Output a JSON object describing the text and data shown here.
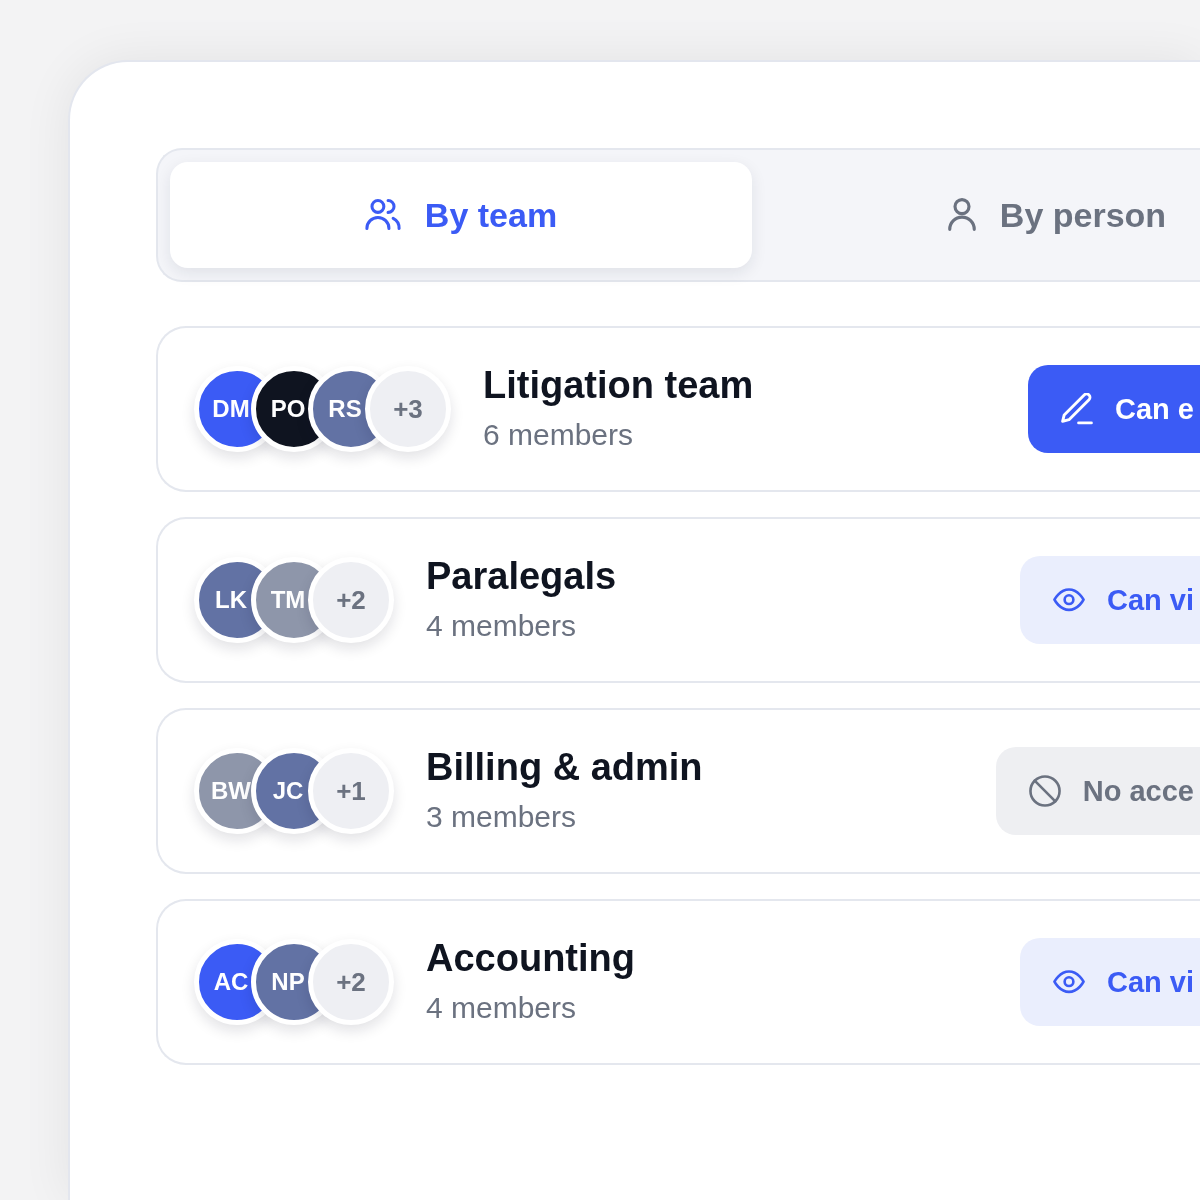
{
  "tabs": [
    {
      "label": "By team",
      "kind": "team",
      "selected": true
    },
    {
      "label": "By person",
      "kind": "person",
      "selected": false
    }
  ],
  "teams": [
    {
      "avatars": [
        {
          "initials": "DM",
          "color": "#3b5bf5"
        },
        {
          "initials": "PO",
          "color": "#0f1420"
        },
        {
          "initials": "RS",
          "color": "#6272a4"
        }
      ],
      "more": "+3",
      "name": "Litigation team",
      "members": "6 members",
      "access": {
        "kind": "edit",
        "label": "Can e"
      }
    },
    {
      "avatars": [
        {
          "initials": "LK",
          "color": "#6272a4"
        },
        {
          "initials": "TM",
          "color": "#8e96aa"
        }
      ],
      "more": "+2",
      "name": "Paralegals",
      "members": "4 members",
      "access": {
        "kind": "view",
        "label": "Can vi"
      }
    },
    {
      "avatars": [
        {
          "initials": "BW",
          "color": "#8e96aa"
        },
        {
          "initials": "JC",
          "color": "#6272a4"
        }
      ],
      "more": "+1",
      "name": "Billing & admin",
      "members": "3 members",
      "access": {
        "kind": "none",
        "label": "No acce"
      }
    },
    {
      "avatars": [
        {
          "initials": "AC",
          "color": "#3b5bf5"
        },
        {
          "initials": "NP",
          "color": "#6272a4"
        }
      ],
      "more": "+2",
      "name": "Accounting",
      "members": "4 members",
      "access": {
        "kind": "view",
        "label": "Can vi"
      }
    }
  ]
}
